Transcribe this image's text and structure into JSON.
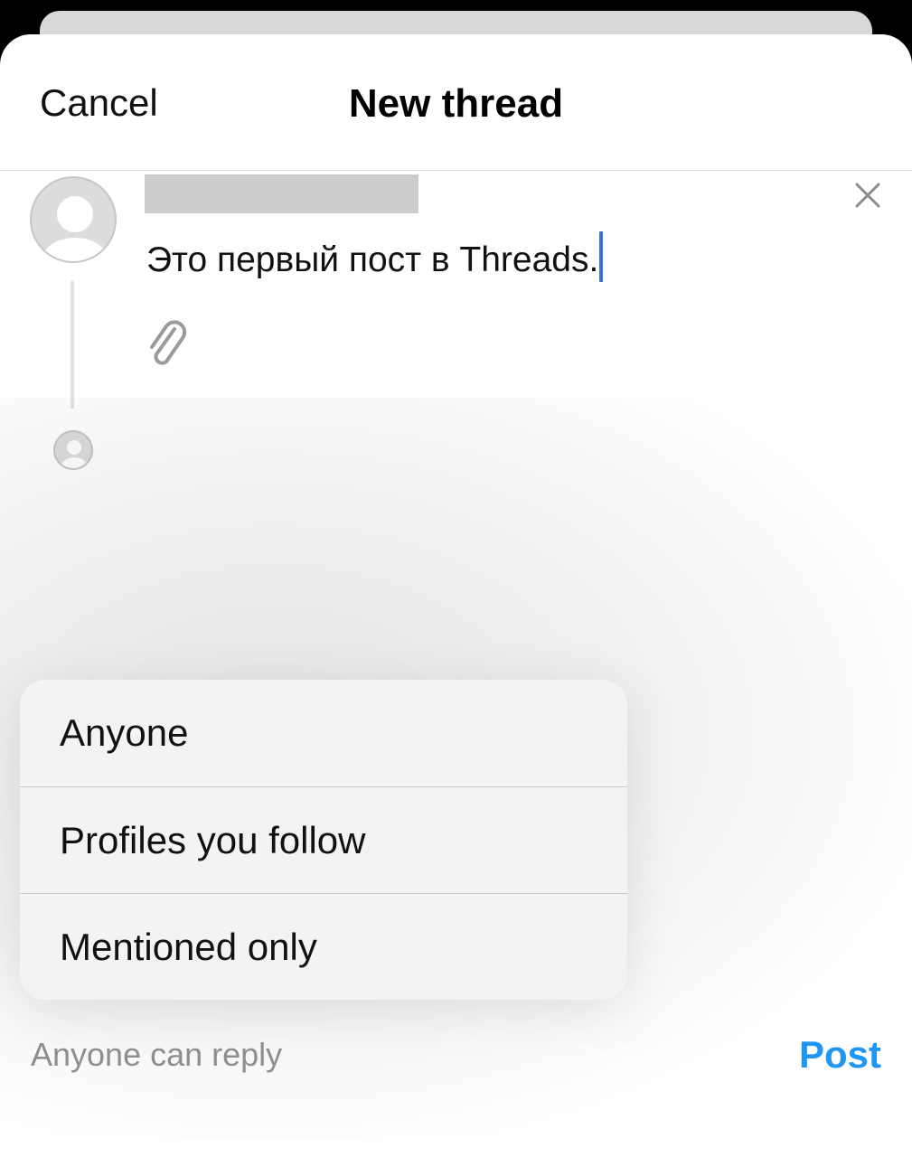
{
  "header": {
    "cancel_label": "Cancel",
    "title": "New thread"
  },
  "composer": {
    "text": "Это первый пост в Threads.",
    "username": ""
  },
  "reply_menu": {
    "options": [
      "Anyone",
      "Profiles you follow",
      "Mentioned only"
    ]
  },
  "footer": {
    "reply_setting": "Anyone can reply",
    "post_label": "Post"
  },
  "icons": {
    "close": "close-icon",
    "attach": "paperclip-icon",
    "avatar": "avatar-icon"
  },
  "colors": {
    "accent": "#1f96f3",
    "cursor": "#3b6fe6",
    "muted_text": "#8e8e8e"
  }
}
